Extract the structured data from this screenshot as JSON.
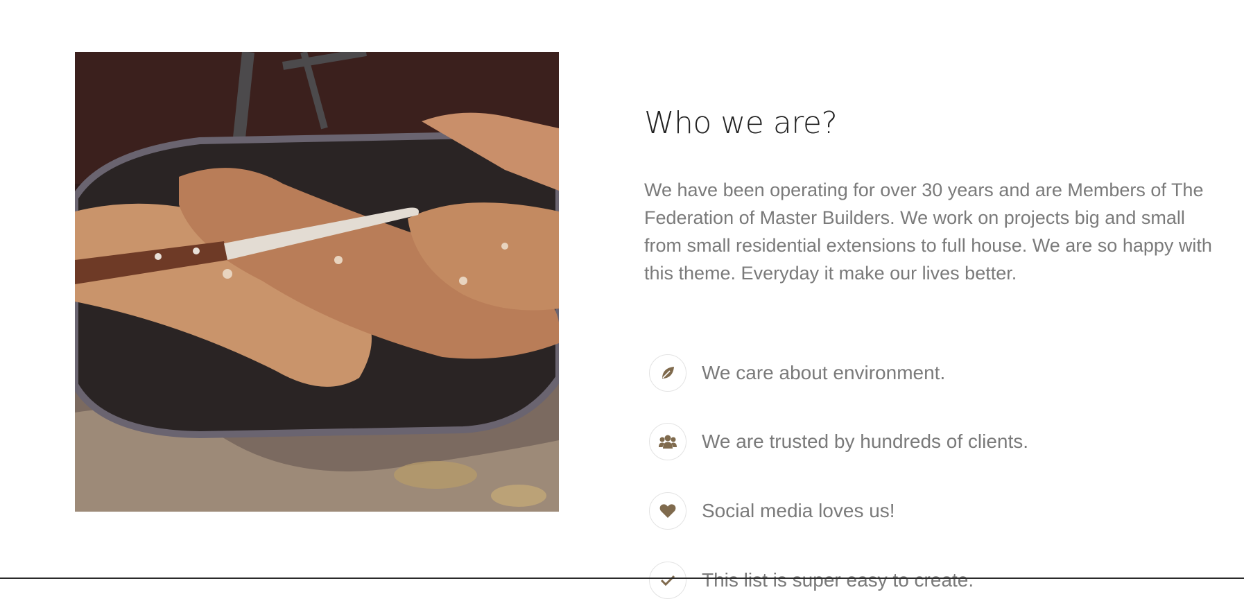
{
  "about": {
    "title": "Who we are?",
    "description": "We have been operating for over 30 years and are Members of The Federation of Master Builders. We work on projects big and small from small residential extensions to full house. We are so happy with this theme. Everyday it make our lives better.",
    "accent_color": "#7f6a4d",
    "features": [
      {
        "icon": "leaf-icon",
        "label": "We care about environment."
      },
      {
        "icon": "users-icon",
        "label": "We are trusted by hundreds of clients."
      },
      {
        "icon": "heart-icon",
        "label": "Social media loves us!"
      },
      {
        "icon": "check-icon",
        "label": "This list is super easy to create."
      }
    ]
  }
}
